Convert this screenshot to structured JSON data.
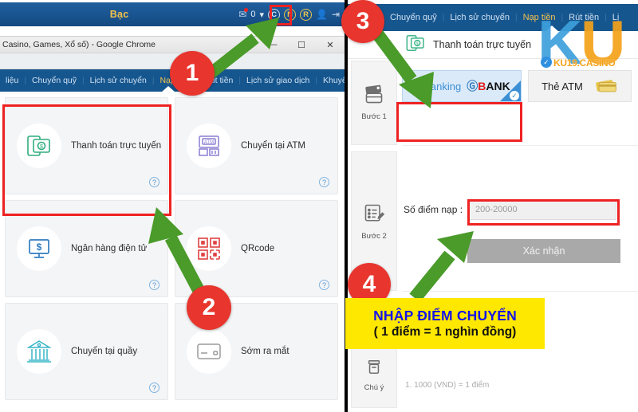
{
  "left_window": {
    "site_topbar": {
      "currency_label": "Bạc",
      "balance_value": "0",
      "icons": [
        "mail-icon",
        "caret-down-icon",
        "circle-c-icon",
        "circle-n-icon",
        "circle-r-icon",
        "person-icon",
        "exit-icon"
      ],
      "circle_c": "C",
      "circle_n": "N",
      "circle_r": "R"
    },
    "chrome": {
      "title": "Casino, Games, Xổ số) - Google Chrome",
      "minimize": "—",
      "maximize": "☐",
      "close": "✕"
    },
    "nav": {
      "items": [
        {
          "label": "liệu",
          "active": false
        },
        {
          "label": "Chuyển quỹ",
          "active": false
        },
        {
          "label": "Lịch sử chuyển",
          "active": false
        },
        {
          "label": "Nạp tiền",
          "active": true
        },
        {
          "label": "Rút tiền",
          "active": false
        },
        {
          "label": "Lịch sử giao dịch",
          "active": false
        },
        {
          "label": "Khuyến mã",
          "active": false
        }
      ]
    },
    "methods": [
      {
        "label": "Thanh toán trực tuyến",
        "icon": "mobile-money-icon",
        "color": "#2fae7e",
        "help": "?"
      },
      {
        "label": "Chuyển tại ATM",
        "icon": "atm-machine-icon",
        "color": "#8b7fd4",
        "help": "?"
      },
      {
        "label": "Ngân hàng điện tử",
        "icon": "monitor-dollar-icon",
        "color": "#2f7cc0",
        "help": "?"
      },
      {
        "label": "QRcode",
        "icon": "qrcode-icon",
        "color": "#e04040",
        "help": "?"
      },
      {
        "label": "Chuyển tại quầy",
        "icon": "bank-building-icon",
        "color": "#39b5c9",
        "help": "?"
      },
      {
        "label": "Sớm ra mắt",
        "icon": "credit-card-icon",
        "color": "#9a9a9a",
        "help": ""
      }
    ]
  },
  "right_window": {
    "nav": {
      "items": [
        {
          "label": "Chuyển quỹ",
          "active": false
        },
        {
          "label": "Lịch sử chuyển",
          "active": false
        },
        {
          "label": "Nạp tiền",
          "active": true
        },
        {
          "label": "Rút tiền",
          "active": false
        },
        {
          "label": "Lị",
          "active": false
        }
      ]
    },
    "header": {
      "title": "Thanh toán trực tuyến",
      "icon": "mobile-money-icon"
    },
    "steps": [
      {
        "label": "Bước 1",
        "icon": "credit-cards-icon"
      },
      {
        "label": "Bước 2",
        "icon": "form-pencil-icon"
      },
      {
        "label": "Chú ý",
        "icon": "note-icon"
      }
    ],
    "step1": {
      "tab_ebanking": {
        "text": "E-Banking",
        "brand_g": "Ⓖ",
        "brand_b": "B",
        "brand_rest": "ANK",
        "selected": true,
        "check": "✓"
      },
      "tab_atm": {
        "text": "Thẻ ATM",
        "icon": "cards-stack-icon",
        "selected": false
      }
    },
    "step2": {
      "amount_label": "Số điểm nạp :",
      "amount_placeholder": "200-20000",
      "amount_value": "",
      "confirm_label": "Xác nhận"
    },
    "notes": {
      "line1": "1.  1000 (VND) = 1 điểm"
    }
  },
  "annotations": {
    "badges": [
      {
        "number": "1"
      },
      {
        "number": "2"
      },
      {
        "number": "3"
      },
      {
        "number": "4"
      }
    ],
    "yellow_note": {
      "line1": "NHẬP ĐIỂM CHUYỂN",
      "line2": "( 1 điểm = 1 nghìn đồng)",
      "bg_color": "#ffe800",
      "line1_color": "#1414e8",
      "line2_color": "#111111"
    },
    "highlight_color": "#ee2222",
    "arrow_color": "#4a9b2a",
    "badge_color": "#e8352e"
  },
  "watermark": {
    "logo_k": "K",
    "logo_u": "U",
    "site_text": "KU19.CASINO",
    "badge_icon": "check-badge-icon",
    "k_color": "#3ea0dd",
    "u_color": "#f5a21a"
  }
}
